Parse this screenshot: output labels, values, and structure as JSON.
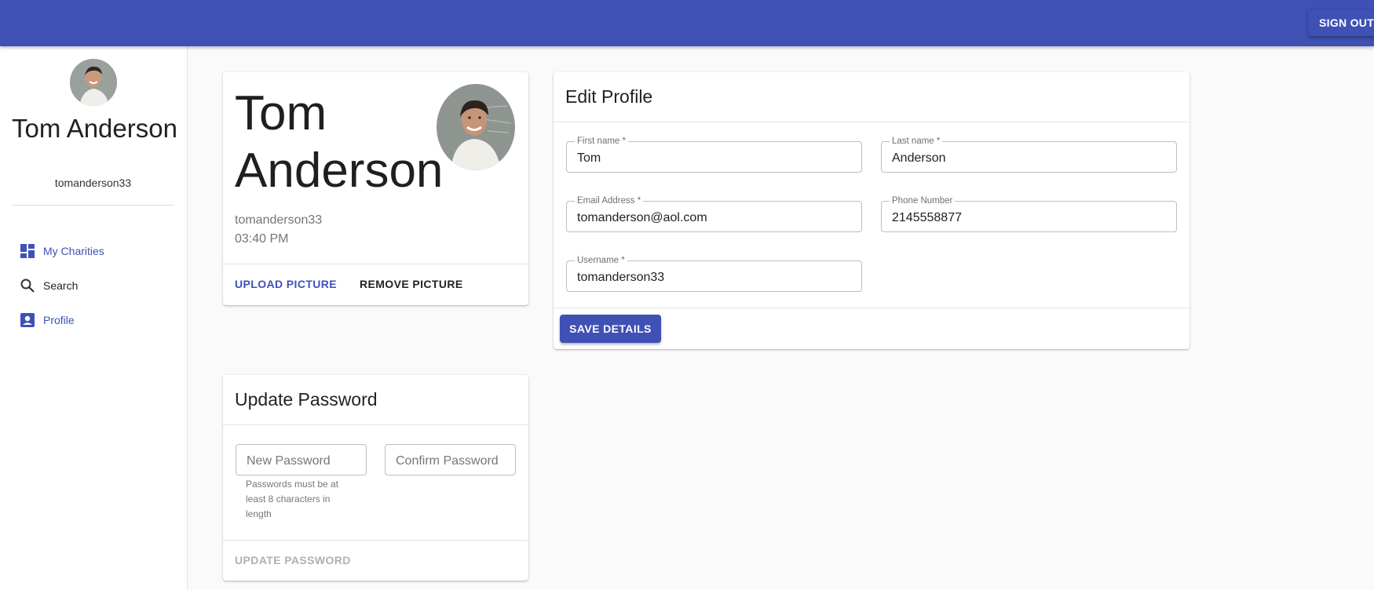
{
  "topbar": {
    "signout_label": "SIGN OUT"
  },
  "sidebar": {
    "name": "Tom Anderson",
    "username": "tomanderson33",
    "items": [
      {
        "label": "My Charities",
        "icon": "dashboard-icon"
      },
      {
        "label": "Search",
        "icon": "search-icon"
      },
      {
        "label": "Profile",
        "icon": "account-box-icon"
      }
    ]
  },
  "profile_card": {
    "name": "Tom Anderson",
    "username": "tomanderson33",
    "time": "03:40 PM",
    "upload_label": "UPLOAD PICTURE",
    "remove_label": "REMOVE PICTURE"
  },
  "edit_profile": {
    "title": "Edit Profile",
    "first_name": {
      "label": "First name *",
      "value": "Tom"
    },
    "last_name": {
      "label": "Last name *",
      "value": "Anderson"
    },
    "email": {
      "label": "Email Address *",
      "value": "tomanderson@aol.com"
    },
    "phone": {
      "label": "Phone Number",
      "value": "2145558877"
    },
    "username": {
      "label": "Username *",
      "value": "tomanderson33"
    },
    "save_label": "SAVE DETAILS"
  },
  "update_password": {
    "title": "Update Password",
    "new_placeholder": "New Password",
    "confirm_placeholder": "Confirm Password",
    "hint": "Passwords must be at least 8 characters in length",
    "button_label": "UPDATE PASSWORD"
  },
  "colors": {
    "primary": "#3f51b5",
    "background": "#fafafa",
    "disabled_text": "#b0b0b0"
  }
}
